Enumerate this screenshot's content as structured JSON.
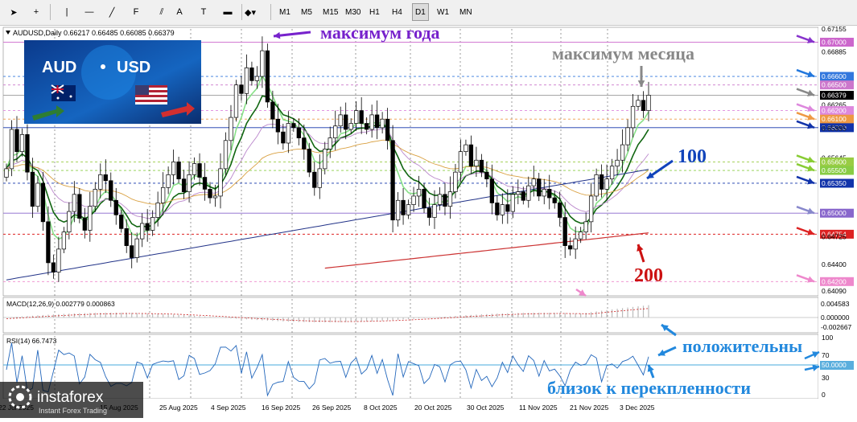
{
  "toolbar": {
    "tools": [
      {
        "name": "cursor-icon",
        "glyph": "➤"
      },
      {
        "name": "crosshair-icon",
        "glyph": "+"
      },
      {
        "name": "vertical-line-icon",
        "glyph": "|"
      },
      {
        "name": "horizontal-line-icon",
        "glyph": "—"
      },
      {
        "name": "trendline-icon",
        "glyph": "╱"
      },
      {
        "name": "fibonacci-icon",
        "glyph": "F"
      },
      {
        "name": "channel-icon",
        "glyph": "⫽"
      },
      {
        "name": "text-icon",
        "glyph": "A"
      },
      {
        "name": "text-label-icon",
        "glyph": "T"
      },
      {
        "name": "rectangle-icon",
        "glyph": "▬"
      },
      {
        "name": "shapes-menu-icon",
        "glyph": "◆▾"
      }
    ],
    "timeframes": [
      "M1",
      "M5",
      "M15",
      "M30",
      "H1",
      "H4",
      "D1",
      "W1",
      "MN"
    ],
    "active_timeframe": "D1"
  },
  "chart": {
    "symbol_info": "AUDUSD,Daily  0.66217 0.66485 0.66085 0.66379",
    "logo_text_aud": "AUD",
    "logo_text_usd": "USD",
    "price_labels": [
      {
        "text": "0.67155",
        "color": "#000000",
        "bg": ""
      },
      {
        "text": "0.67000",
        "color": "#ffffff",
        "bg": "#cc66cc"
      },
      {
        "text": "0.66885",
        "color": "#000000",
        "bg": ""
      },
      {
        "text": "0.66600",
        "color": "#ffffff",
        "bg": "#3377dd"
      },
      {
        "text": "0.66500",
        "color": "#ffffff",
        "bg": "#cc77cc"
      },
      {
        "text": "0.66379",
        "color": "#ffffff",
        "bg": "#000000"
      },
      {
        "text": "0.66265",
        "color": "#000000",
        "bg": ""
      },
      {
        "text": "0.66200",
        "color": "#ffffff",
        "bg": "#dd88dd"
      },
      {
        "text": "0.66100",
        "color": "#ffffff",
        "bg": "#ee9944"
      },
      {
        "text": "0.66000",
        "color": "#ffffff",
        "bg": "#1133aa"
      },
      {
        "text": "0.65995",
        "color": "#000000",
        "bg": ""
      },
      {
        "text": "0.65645",
        "color": "#000000",
        "bg": ""
      },
      {
        "text": "0.65600",
        "color": "#ffffff",
        "bg": "#99cc44"
      },
      {
        "text": "0.65500",
        "color": "#ffffff",
        "bg": "#88cc44"
      },
      {
        "text": "0.65350",
        "color": "#ffffff",
        "bg": "#1133aa"
      },
      {
        "text": "0.65000",
        "color": "#ffffff",
        "bg": "#8866cc"
      },
      {
        "text": "0.64754",
        "color": "#ffffff",
        "bg": "#dd2222"
      },
      {
        "text": "0.64725",
        "color": "#000000",
        "bg": ""
      },
      {
        "text": "0.64400",
        "color": "#000000",
        "bg": ""
      },
      {
        "text": "0.64200",
        "color": "#ffffff",
        "bg": "#ee88cc"
      },
      {
        "text": "0.64090",
        "color": "#000000",
        "bg": ""
      }
    ],
    "date_labels": [
      "22 Jul 2025",
      "15 Aug 2025",
      "25 Aug 2025",
      "4 Sep 2025",
      "16 Sep 2025",
      "26 Sep 2025",
      "8 Oct 2025",
      "20 Oct 2025",
      "30 Oct 2025",
      "11 Nov 2025",
      "21 Nov 2025",
      "3 Dec 2025"
    ],
    "annotations": {
      "year_high": "максимум года",
      "month_high": "максимум месяца",
      "ma100": "100",
      "ma200": "200",
      "positive": "положительны",
      "near_overbought": "близок к перекпленности"
    }
  },
  "macd": {
    "title": "MACD(12,26,9) 0.002779 0.000863",
    "scale": [
      "0.004583",
      "0.000000",
      "-0.002667"
    ]
  },
  "rsi": {
    "title": "RSI(14) 66.7473",
    "scale": [
      "100",
      "70",
      "50.0000",
      "30",
      "0"
    ]
  },
  "watermark": {
    "brand": "instaforex",
    "tagline": "Instant Forex Trading"
  },
  "colors": {
    "bull_candle": "#ffffff",
    "bear_candle": "#000000",
    "ma_fast_light": "#88e088",
    "ma_dark_green": "#116611",
    "ma_orange": "#d9a040",
    "ma_blue": "#223388",
    "ma_purple": "#bb88cc",
    "ma_red": "#cc3333",
    "annotation_purple": "#7722cc",
    "annotation_blue": "#1144bb",
    "annotation_red": "#cc1111",
    "annotation_gray": "#888888",
    "annotation_cyan": "#2288dd"
  }
}
